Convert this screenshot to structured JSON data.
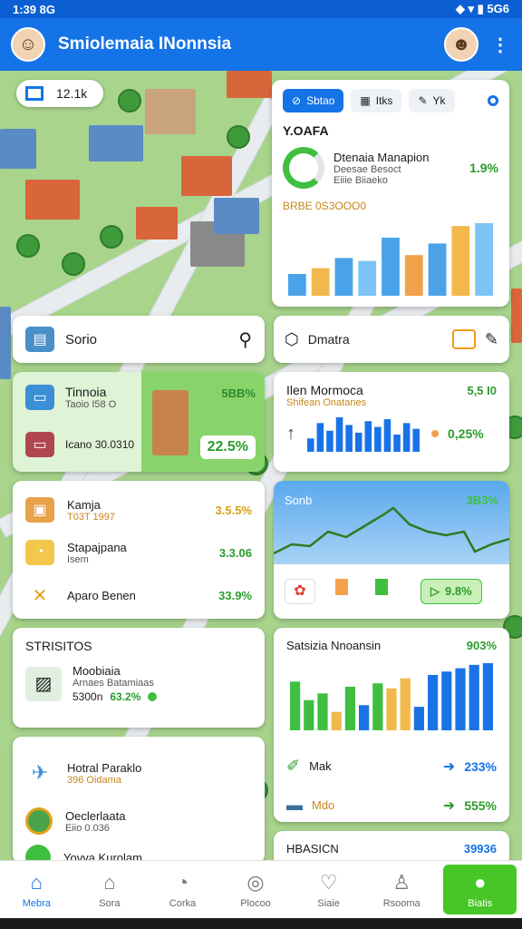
{
  "status": {
    "time": "1:39 8G",
    "right": "5G6"
  },
  "header": {
    "title": "Smiolemaia INonnsia"
  },
  "map_pill": {
    "value": "12.1k"
  },
  "overview": {
    "tabs": [
      "Sbtao",
      "Itks",
      "Yk"
    ],
    "section": "Y.OAFA",
    "item_title": "Dtenaia Manapion",
    "item_sub": "Deesae Besoct",
    "item_meta": "Eiiie Biiaeko",
    "item_pct": "1.9%",
    "bars_label": "BRBE 0S3OOO0"
  },
  "chart_bars": [
    30,
    38,
    52,
    48,
    80,
    56,
    72,
    96,
    100
  ],
  "bar_colors": [
    "#4aa3e8",
    "#f2b84b",
    "#4aa3e8",
    "#7cc4f5",
    "#4aa3e8",
    "#f2a14b",
    "#4aa3e8",
    "#f2b84b",
    "#7cc4f5"
  ],
  "search": {
    "label": "Sorio"
  },
  "filter": {
    "label": "Dmatra"
  },
  "transit": {
    "title": "Tinnoia",
    "sub": "Taoio I58 O",
    "row2": "Icano 30.0310",
    "pct_big": "22.5%",
    "pct_top": "5BB%"
  },
  "nen": {
    "title": "Ilen Mormoca",
    "sub": "Shifean Onatanes",
    "pct_top": "5,5 I0",
    "pct": "0,25%"
  },
  "list1": [
    {
      "title": "Kamja",
      "sub": "T03T 1997",
      "pct": "3.5.5%",
      "color": "yellow"
    },
    {
      "title": "Stapajpana",
      "sub": "Isem",
      "pct": "3.3.06",
      "color": "green"
    },
    {
      "title": "Aparo Benen",
      "sub": "",
      "pct": "33.9%",
      "color": "green"
    }
  ],
  "trend": {
    "label": "Sonb",
    "pct": "3B3%",
    "badge": "9.8%"
  },
  "stats": {
    "title": "STRISITOS",
    "item_title": "Moobiaia",
    "item_sub": "Arnaes Batamiaas",
    "item_meta": "5300n",
    "item_pct": "63.2%"
  },
  "stats2": {
    "title": "Satsizia Nnoansin",
    "pct": "903%",
    "row1": "Mak",
    "row1_pct": "233%",
    "row2": "Mdo",
    "row2_pct": "555%"
  },
  "stats2_bars": [
    58,
    36,
    44,
    22,
    52,
    30,
    56,
    50,
    62,
    28,
    66,
    70,
    74,
    78,
    80
  ],
  "stats2_colors": [
    "#3fbf3f",
    "#3fbf3f",
    "#3fbf3f",
    "#f2b84b",
    "#3fbf3f",
    "#1a73e6",
    "#3fbf3f",
    "#f2b84b",
    "#f2b84b",
    "#1a73e6",
    "#1a73e6",
    "#1a73e6",
    "#1a73e6",
    "#1a73e6",
    "#1a73e6"
  ],
  "hotel": {
    "title": "Hotral Paraklo",
    "sub": "396 Oidama",
    "row2_title": "Oeclerlaata",
    "row2_sub": "Eiio 0.036"
  },
  "partial": {
    "title": "Yovva Kurolam",
    "right_title": "HBASICN",
    "right_pct": "39936"
  },
  "nav": [
    "Mebra",
    "Sora",
    "Corka",
    "Plocoo",
    "Siaie",
    "Rsooma",
    "Biatis"
  ]
}
